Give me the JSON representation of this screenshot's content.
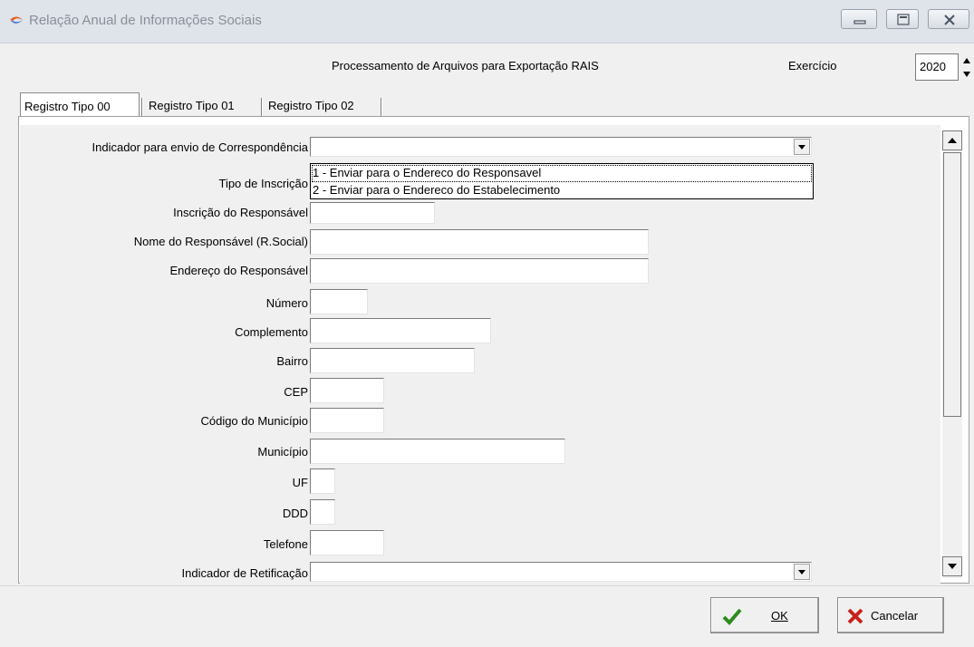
{
  "window": {
    "title": "Relação Anual de Informações Sociais"
  },
  "header": {
    "title": "Processamento de Arquivos para Exportação RAIS",
    "exercicio_label": "Exercício",
    "exercicio_value": "2020"
  },
  "tabs": [
    {
      "label": "Registro Tipo 00",
      "active": true
    },
    {
      "label": "Registro Tipo 01",
      "active": false
    },
    {
      "label": "Registro Tipo 02",
      "active": false
    }
  ],
  "form": {
    "fields": [
      {
        "label": "Indicador para envio de Correspondência",
        "value": ""
      },
      {
        "label": "Tipo de Inscrição",
        "value": ""
      },
      {
        "label": "Inscrição do Responsável",
        "value": ""
      },
      {
        "label": "Nome do Responsável (R.Social)",
        "value": ""
      },
      {
        "label": "Endereço do Responsável",
        "value": ""
      },
      {
        "label": "Número",
        "value": ""
      },
      {
        "label": "Complemento",
        "value": ""
      },
      {
        "label": "Bairro",
        "value": ""
      },
      {
        "label": "CEP",
        "value": ""
      },
      {
        "label": "Código do Município",
        "value": ""
      },
      {
        "label": "Município",
        "value": ""
      },
      {
        "label": "UF",
        "value": ""
      },
      {
        "label": "DDD",
        "value": ""
      },
      {
        "label": "Telefone",
        "value": ""
      },
      {
        "label": "Indicador de Retificação",
        "value": ""
      }
    ],
    "dropdown_options": [
      "1 - Enviar para o Endereco do Responsavel",
      "2 - Enviar para o Endereco do Estabelecimento"
    ]
  },
  "footer": {
    "ok_label": "OK",
    "cancel_label": "Cancelar"
  },
  "icons": {
    "app": "app-arrow-icon",
    "minimize": "minimize-icon",
    "maximize": "maximize-icon",
    "close": "close-icon",
    "ok": "checkmark-icon",
    "cancel": "x-icon"
  },
  "colors": {
    "titlebar_bg": "#dfe3ea",
    "title_text": "#8a8f98",
    "ok_icon": "#2e8b1e",
    "cancel_icon": "#c8211b",
    "app_icon": "#e35a1a"
  }
}
